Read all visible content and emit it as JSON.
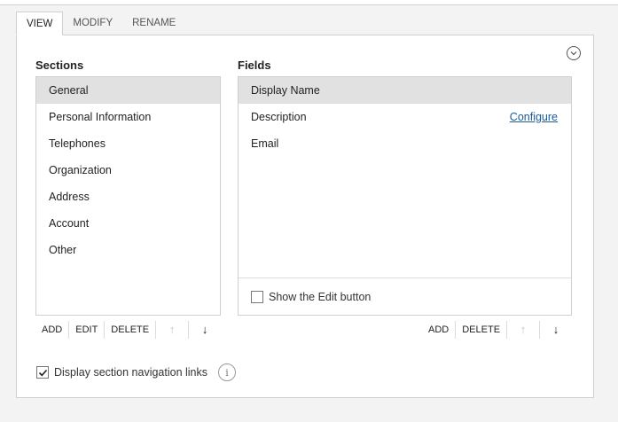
{
  "tabs": [
    {
      "label": "VIEW",
      "active": true
    },
    {
      "label": "MODIFY",
      "active": false
    },
    {
      "label": "RENAME",
      "active": false
    }
  ],
  "collapse_icon": "chevron-down-circle-icon",
  "sections": {
    "title": "Sections",
    "items": [
      "General",
      "Personal Information",
      "Telephones",
      "Organization",
      "Address",
      "Account",
      "Other"
    ],
    "selected": "General",
    "toolbar": {
      "add": "ADD",
      "edit": "EDIT",
      "delete": "DELETE",
      "up_icon": "arrow-up-icon",
      "down_icon": "arrow-down-icon"
    }
  },
  "fields": {
    "title": "Fields",
    "items": [
      "Display Name",
      "Description",
      "Email"
    ],
    "selected": "Display Name",
    "configure_link": "Configure",
    "show_edit_button": {
      "label": "Show the Edit button",
      "checked": false
    },
    "toolbar": {
      "add": "ADD",
      "delete": "DELETE",
      "up_icon": "arrow-up-icon",
      "down_icon": "arrow-down-icon"
    }
  },
  "display_nav_links": {
    "label": "Display section navigation links",
    "checked": true
  },
  "info_icon": "info-icon",
  "colors": {
    "link": "#1a5a9a",
    "selected_bg": "#e1e1e1",
    "border": "#d0d0d0"
  }
}
